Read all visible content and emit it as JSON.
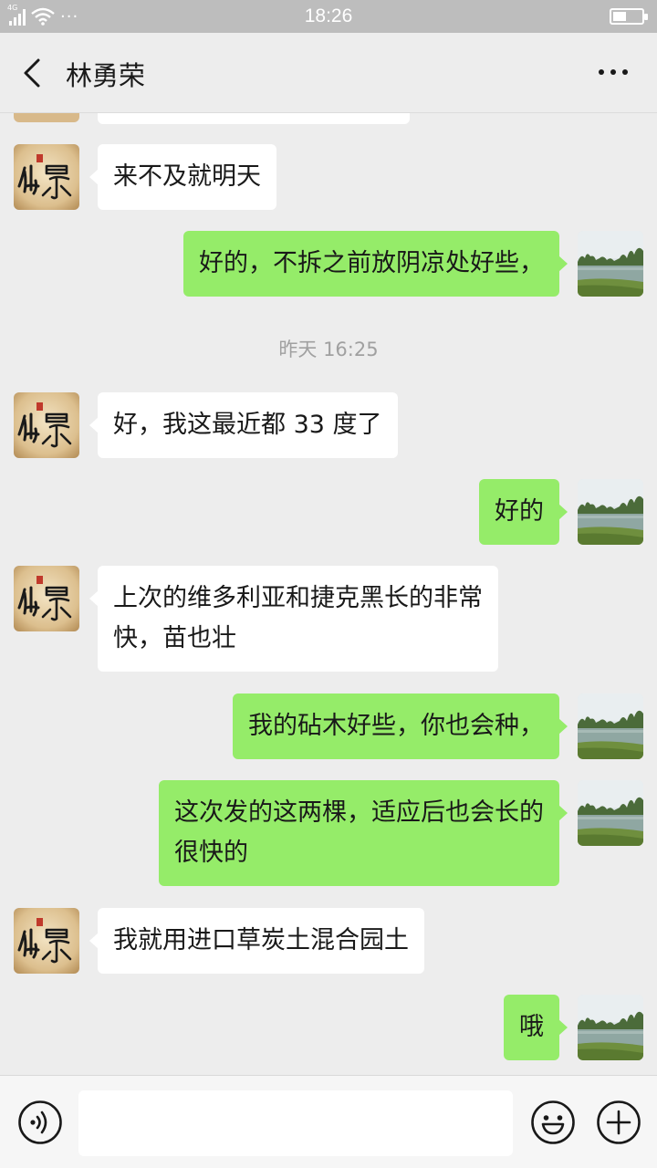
{
  "status_bar": {
    "network": "4G",
    "time": "18:26",
    "battery_level": 0.45
  },
  "header": {
    "back_icon": "chevron-left-icon",
    "title": "林勇荣",
    "more_icon": "more-dots-icon"
  },
  "messages": [
    {
      "side": "left",
      "text": ""
    },
    {
      "side": "left",
      "text": "来不及就明天"
    },
    {
      "side": "right",
      "text": "好的，不拆之前放阴凉处好些，"
    },
    {
      "type": "timestamp",
      "text": "昨天 16:25"
    },
    {
      "side": "left",
      "text": "好，我这最近都 33 度了"
    },
    {
      "side": "right",
      "text": "好的"
    },
    {
      "side": "left",
      "text": "上次的维多利亚和捷克黑长的非常\n快，苗也壮"
    },
    {
      "side": "right",
      "text": "我的砧木好些，你也会种，"
    },
    {
      "side": "right",
      "text": "这次发的这两棵，适应后也会长的\n很快的"
    },
    {
      "side": "left",
      "text": "我就用进口草炭土混合园土"
    },
    {
      "side": "right",
      "text": "哦"
    }
  ],
  "contact_avatar": {
    "logo_text": "仙景",
    "seal_text": "印"
  },
  "input_bar": {
    "voice_icon": "voice-icon",
    "input_value": "",
    "emoji_icon": "emoji-icon",
    "add_icon": "plus-icon"
  },
  "colors": {
    "background": "#ededed",
    "status_bar": "#bdbdbd",
    "bubble_sent": "#95ec69",
    "bubble_received": "#ffffff",
    "timestamp_text": "#a0a0a0"
  }
}
